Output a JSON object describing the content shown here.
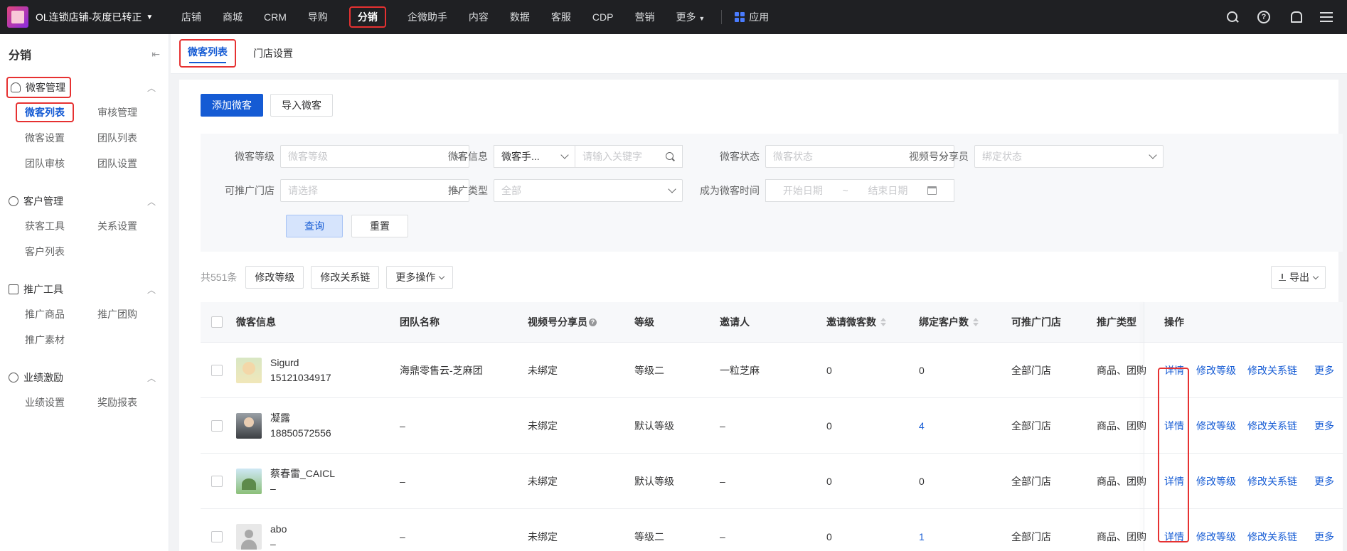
{
  "topbar": {
    "shop_name": "OL连锁店铺-灰度已转正",
    "nav": [
      "店铺",
      "商城",
      "CRM",
      "导购",
      "分销",
      "企微助手",
      "内容",
      "数据",
      "客服",
      "CDP",
      "营销",
      "更多"
    ],
    "active_nav": "分销",
    "app_label": "应用"
  },
  "sidebar": {
    "title": "分销",
    "groups": [
      {
        "label": "微客管理",
        "items": [
          "微客列表",
          "审核管理",
          "微客设置",
          "团队列表",
          "团队审核",
          "团队设置"
        ]
      },
      {
        "label": "客户管理",
        "items": [
          "获客工具",
          "关系设置",
          "客户列表"
        ]
      },
      {
        "label": "推广工具",
        "items": [
          "推广商品",
          "推广团购",
          "推广素材"
        ]
      },
      {
        "label": "业绩激励",
        "items": [
          "业绩设置",
          "奖励报表"
        ]
      }
    ]
  },
  "tabs": [
    "微客列表",
    "门店设置"
  ],
  "actions": {
    "add": "添加微客",
    "import": "导入微客"
  },
  "filter": {
    "level_label": "微客等级",
    "level_placeholder": "微客等级",
    "info_label": "微客信息",
    "info_type": "微客手...",
    "info_placeholder": "请输入关键字",
    "status_label": "微客状态",
    "status_placeholder": "微客状态",
    "share_label": "视频号分享员",
    "share_placeholder": "绑定状态",
    "store_label": "可推广门店",
    "store_placeholder": "请选择",
    "type_label": "推广类型",
    "type_value": "全部",
    "time_label": "成为微客时间",
    "start_placeholder": "开始日期",
    "date_sep": "~",
    "end_placeholder": "结束日期",
    "query": "查询",
    "reset": "重置"
  },
  "toolbar": {
    "count": "共551条",
    "edit_level": "修改等级",
    "edit_chain": "修改关系链",
    "more_ops": "更多操作",
    "export": "导出"
  },
  "table": {
    "headers": [
      "微客信息",
      "团队名称",
      "视频号分享员",
      "等级",
      "邀请人",
      "邀请微客数",
      "绑定客户数",
      "可推广门店",
      "推广类型",
      "操作"
    ],
    "rows": [
      {
        "name": "Sigurd",
        "phone": "15121034917",
        "team": "海鼎零售云-芝麻团",
        "share": "未绑定",
        "level": "等级二",
        "inviter": "一粒芝麻",
        "invited": "0",
        "bound": "0",
        "stores": "全部门店",
        "ptype": "商品、团购"
      },
      {
        "name": "凝露",
        "phone": "18850572556",
        "team": "–",
        "share": "未绑定",
        "level": "默认等级",
        "inviter": "–",
        "invited": "0",
        "bound": "4",
        "stores": "全部门店",
        "ptype": "商品、团购"
      },
      {
        "name": "蔡春雷_CAICL",
        "phone": "–",
        "team": "–",
        "share": "未绑定",
        "level": "默认等级",
        "inviter": "–",
        "invited": "0",
        "bound": "0",
        "stores": "全部门店",
        "ptype": "商品、团购"
      },
      {
        "name": "abo",
        "phone": "–",
        "team": "–",
        "share": "未绑定",
        "level": "等级二",
        "inviter": "–",
        "invited": "0",
        "bound": "1",
        "stores": "全部门店",
        "ptype": "商品、团购"
      }
    ],
    "ops": [
      "详情",
      "修改等级",
      "修改关系链",
      "更多"
    ]
  },
  "colors": {
    "accent": "#155bd4",
    "highlight": "#e63131",
    "topbar": "#1f2023"
  }
}
